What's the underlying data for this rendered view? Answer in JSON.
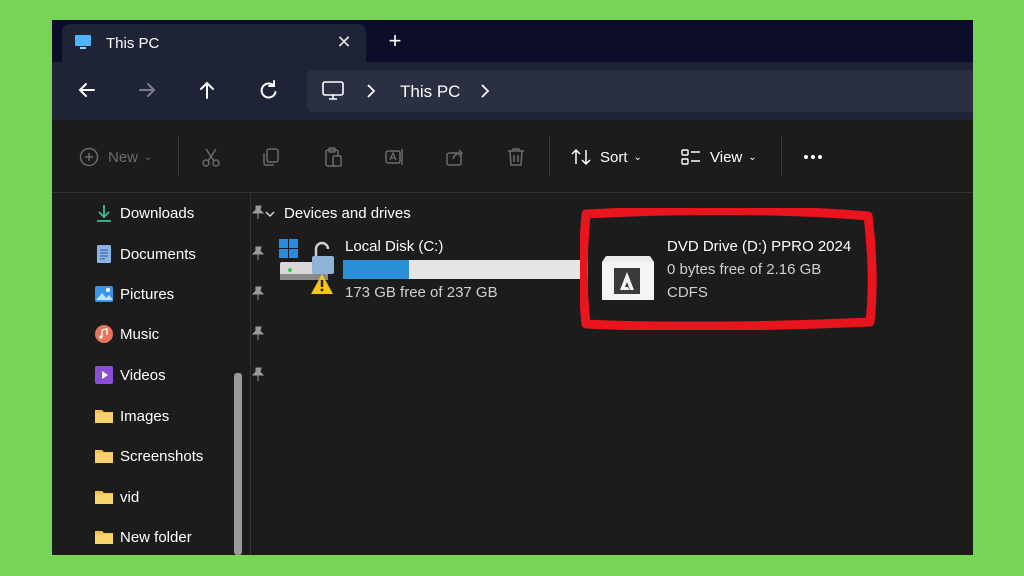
{
  "window": {
    "tab": {
      "title": "This PC",
      "close_icon": "close-icon"
    },
    "new_tab_icon": "plus-icon"
  },
  "nav": {
    "back_icon": "arrow-left-icon",
    "forward_icon": "arrow-right-icon",
    "up_icon": "arrow-up-icon",
    "refresh_icon": "refresh-icon",
    "address": {
      "path_label": "This PC"
    }
  },
  "toolbar": {
    "new_label": "New",
    "sort_label": "Sort",
    "view_label": "View",
    "more_icon": "more-icon",
    "icons": [
      "cut-icon",
      "copy-icon",
      "paste-icon",
      "rename-icon",
      "share-icon",
      "delete-icon"
    ]
  },
  "sidebar": {
    "items": [
      {
        "label": "Downloads",
        "icon": "download-icon",
        "pinned": true
      },
      {
        "label": "Documents",
        "icon": "documents-icon",
        "pinned": true
      },
      {
        "label": "Pictures",
        "icon": "pictures-icon",
        "pinned": true
      },
      {
        "label": "Music",
        "icon": "music-icon",
        "pinned": true
      },
      {
        "label": "Videos",
        "icon": "videos-icon",
        "pinned": true
      },
      {
        "label": "Images",
        "icon": "folder-icon",
        "pinned": false
      },
      {
        "label": "Screenshots",
        "icon": "folder-icon",
        "pinned": false
      },
      {
        "label": "vid",
        "icon": "folder-icon",
        "pinned": false
      },
      {
        "label": "New folder",
        "icon": "folder-icon",
        "pinned": false
      }
    ]
  },
  "content": {
    "section_title": "Devices and drives",
    "drives": [
      {
        "name": "Local Disk (C:)",
        "free_text": "173 GB free of 237 GB",
        "used_fraction": 0.27
      },
      {
        "name": "DVD Drive (D:) PPRO 2024",
        "free_text": "0 bytes free of 2.16 GB",
        "filesystem": "CDFS"
      }
    ]
  },
  "colors": {
    "background_border": "#77d455",
    "highlight": "#e8141e",
    "accent_bar": "#2a90d8"
  }
}
